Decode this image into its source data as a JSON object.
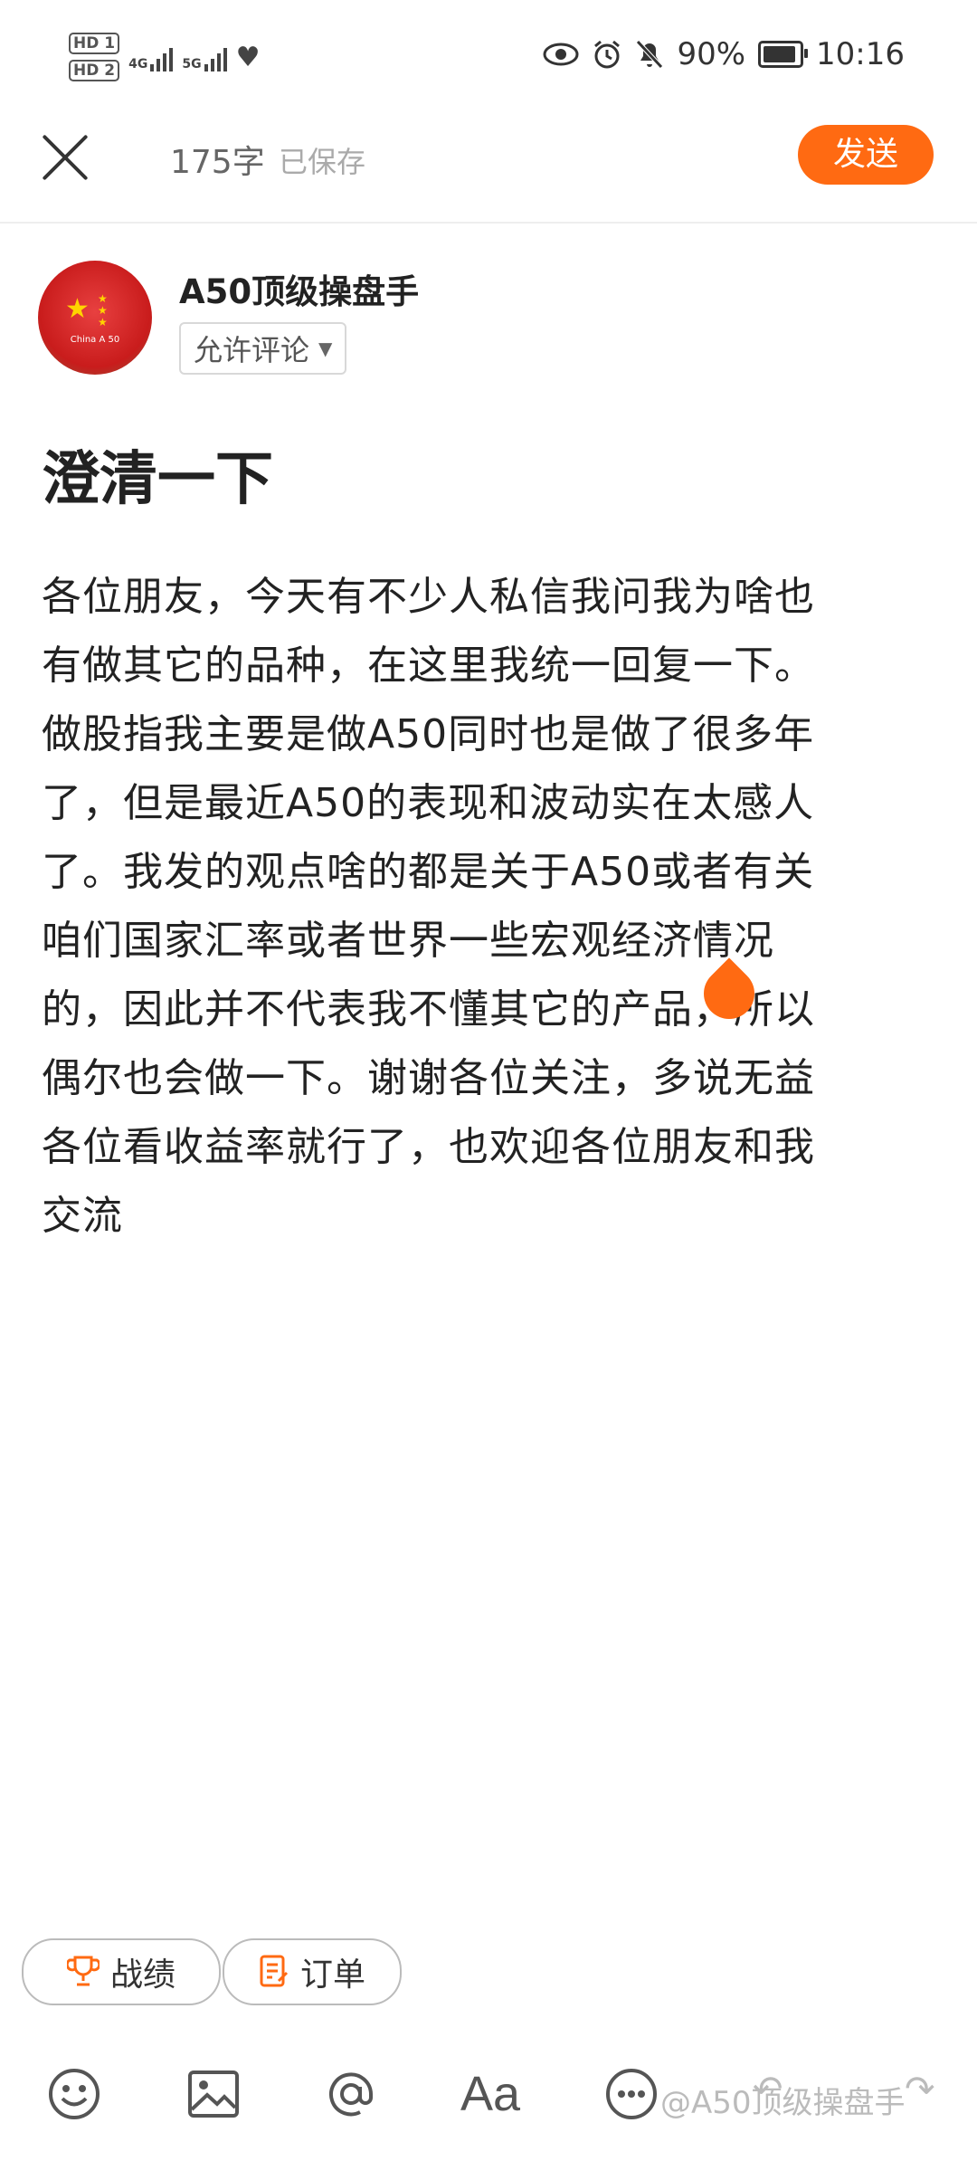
{
  "status_bar": {
    "hd1": "HD 1",
    "hd2": "HD 2",
    "net1": "4G",
    "net2": "5G",
    "battery": "90%",
    "time": "10:16"
  },
  "header": {
    "word_count": "175字",
    "saved": "已保存",
    "send_label": "发送"
  },
  "author": {
    "name": "A50顶级操盘手",
    "avatar_caption": "China A 50",
    "comment_option": "允许评论"
  },
  "post": {
    "title": "澄清一下",
    "lines": [
      "各位朋友，今天有不少人私信我问我为啥也",
      "有做其它的品种，在这里我统一回复一下。",
      "做股指我主要是做A50同时也是做了很多年",
      "了，但是最近A50的表现和波动实在太感人",
      "了。我发的观点啥的都是关于A50或者有关",
      "咱们国家汇率或者世界一些宏观经济情况",
      "的，因此并不代表我不懂其它的产品，所以",
      "偶尔也会做一下。谢谢各位关注，多说无益",
      "各位看收益率就行了，也欢迎各位朋友和我",
      "交流"
    ]
  },
  "chips": {
    "record": "战绩",
    "order": "订单"
  },
  "toolbar": {
    "font_label": "Aa",
    "watermark": "@A50顶级操盘手"
  },
  "colors": {
    "accent": "#ff6a12"
  }
}
